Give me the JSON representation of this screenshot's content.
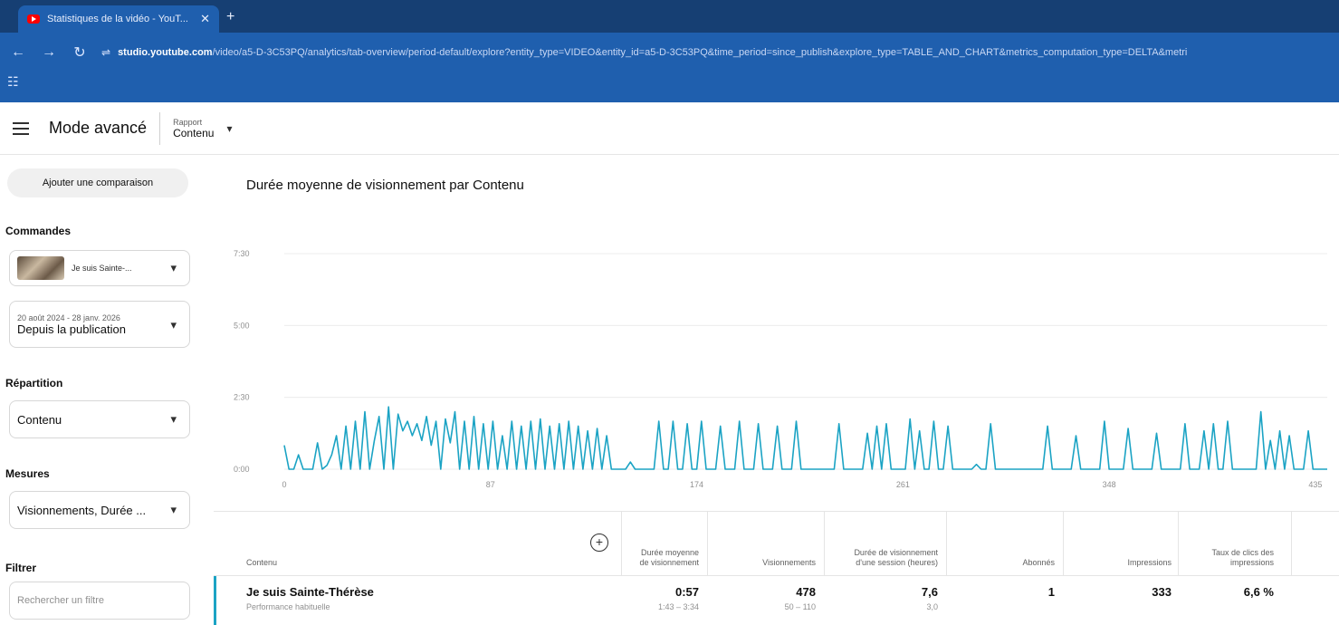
{
  "browser": {
    "tab_title": "Statistiques de la vidéo - YouT...",
    "url_host": "studio.youtube.com",
    "url_path": "/video/a5-D-3C53PQ/analytics/tab-overview/period-default/explore?entity_type=VIDEO&entity_id=a5-D-3C53PQ&time_period=since_publish&explore_type=TABLE_AND_CHART&metrics_computation_type=DELTA&metri",
    "icons": [
      "back-icon",
      "forward-icon",
      "reload-icon",
      "site-info-icon",
      "bookmarks-icon"
    ]
  },
  "header": {
    "title": "Mode avancé",
    "report_label": "Rapport",
    "report_value": "Contenu"
  },
  "sidebar": {
    "compare_button": "Ajouter une comparaison",
    "commandes_title": "Commandes",
    "video_select": "Je suis Sainte-...",
    "date_range": "20 août 2024 - 28 janv. 2026",
    "period": "Depuis la publication",
    "repartition_title": "Répartition",
    "repartition_value": "Contenu",
    "mesures_title": "Mesures",
    "mesures_value": "Visionnements, Durée ...",
    "filtrer_title": "Filtrer",
    "filter_placeholder": "Rechercher un filtre"
  },
  "main": {
    "chart_title": "Durée moyenne de visionnement par Contenu"
  },
  "chart_data": {
    "type": "line",
    "title": "Durée moyenne de visionnement par Contenu",
    "ylim": [
      0,
      450
    ],
    "y_ticks": [
      "0:00",
      "2:30",
      "5:00",
      "7:30"
    ],
    "x_ticks": [
      "0",
      "87",
      "174",
      "261",
      "348",
      "435"
    ],
    "xlim": [
      0,
      440
    ],
    "grid": true,
    "line_color": "#1ba3c4",
    "series": [
      {
        "values": [
          [
            0,
            50
          ],
          [
            2,
            0
          ],
          [
            4,
            0
          ],
          [
            6,
            30
          ],
          [
            8,
            0
          ],
          [
            10,
            0
          ],
          [
            12,
            0
          ],
          [
            14,
            55
          ],
          [
            16,
            0
          ],
          [
            18,
            8
          ],
          [
            20,
            30
          ],
          [
            22,
            70
          ],
          [
            24,
            0
          ],
          [
            26,
            90
          ],
          [
            28,
            0
          ],
          [
            30,
            100
          ],
          [
            32,
            0
          ],
          [
            34,
            120
          ],
          [
            36,
            0
          ],
          [
            38,
            60
          ],
          [
            40,
            110
          ],
          [
            42,
            0
          ],
          [
            44,
            130
          ],
          [
            46,
            0
          ],
          [
            48,
            115
          ],
          [
            50,
            80
          ],
          [
            52,
            100
          ],
          [
            54,
            70
          ],
          [
            56,
            95
          ],
          [
            58,
            60
          ],
          [
            60,
            110
          ],
          [
            62,
            50
          ],
          [
            64,
            100
          ],
          [
            66,
            0
          ],
          [
            68,
            105
          ],
          [
            70,
            55
          ],
          [
            72,
            120
          ],
          [
            74,
            0
          ],
          [
            76,
            100
          ],
          [
            78,
            0
          ],
          [
            80,
            110
          ],
          [
            82,
            0
          ],
          [
            84,
            95
          ],
          [
            86,
            0
          ],
          [
            88,
            100
          ],
          [
            90,
            0
          ],
          [
            92,
            70
          ],
          [
            94,
            0
          ],
          [
            96,
            100
          ],
          [
            98,
            0
          ],
          [
            100,
            90
          ],
          [
            102,
            0
          ],
          [
            104,
            100
          ],
          [
            106,
            0
          ],
          [
            108,
            105
          ],
          [
            110,
            0
          ],
          [
            112,
            90
          ],
          [
            114,
            0
          ],
          [
            116,
            95
          ],
          [
            118,
            0
          ],
          [
            120,
            100
          ],
          [
            122,
            0
          ],
          [
            124,
            90
          ],
          [
            126,
            0
          ],
          [
            128,
            80
          ],
          [
            130,
            0
          ],
          [
            132,
            85
          ],
          [
            134,
            0
          ],
          [
            136,
            70
          ],
          [
            138,
            0
          ],
          [
            140,
            0
          ],
          [
            142,
            0
          ],
          [
            144,
            0
          ],
          [
            146,
            15
          ],
          [
            148,
            0
          ],
          [
            150,
            0
          ],
          [
            152,
            0
          ],
          [
            154,
            0
          ],
          [
            156,
            0
          ],
          [
            158,
            0
          ],
          [
            160,
            0
          ],
          [
            162,
            0
          ],
          [
            164,
            0
          ],
          [
            166,
            0
          ],
          [
            168,
            0
          ],
          [
            170,
            0
          ],
          [
            172,
            0
          ],
          [
            174,
            0
          ],
          [
            176,
            0
          ],
          [
            178,
            0
          ],
          [
            180,
            0
          ],
          [
            182,
            0
          ],
          [
            184,
            0
          ],
          [
            186,
            0
          ],
          [
            188,
            0
          ],
          [
            190,
            0
          ],
          [
            192,
            0
          ],
          [
            194,
            0
          ],
          [
            196,
            0
          ],
          [
            198,
            0
          ],
          [
            200,
            0
          ],
          [
            202,
            0
          ],
          [
            204,
            0
          ],
          [
            206,
            0
          ],
          [
            208,
            0
          ],
          [
            210,
            0
          ],
          [
            212,
            0
          ],
          [
            214,
            0
          ],
          [
            216,
            0
          ],
          [
            218,
            0
          ],
          [
            220,
            0
          ],
          [
            222,
            0
          ],
          [
            224,
            0
          ],
          [
            226,
            0
          ],
          [
            228,
            0
          ],
          [
            230,
            0
          ],
          [
            232,
            0
          ],
          [
            234,
            0
          ],
          [
            236,
            0
          ],
          [
            238,
            0
          ],
          [
            240,
            0
          ],
          [
            242,
            0
          ],
          [
            244,
            0
          ],
          [
            246,
            0
          ],
          [
            248,
            0
          ],
          [
            250,
            0
          ],
          [
            252,
            0
          ],
          [
            254,
            0
          ],
          [
            256,
            0
          ],
          [
            258,
            0
          ],
          [
            260,
            0
          ],
          [
            262,
            0
          ],
          [
            264,
            0
          ],
          [
            266,
            0
          ],
          [
            268,
            0
          ],
          [
            270,
            0
          ],
          [
            272,
            0
          ],
          [
            274,
            0
          ],
          [
            276,
            0
          ],
          [
            278,
            0
          ],
          [
            280,
            0
          ],
          [
            282,
            0
          ],
          [
            284,
            0
          ],
          [
            286,
            0
          ],
          [
            288,
            0
          ],
          [
            290,
            0
          ],
          [
            292,
            0
          ],
          [
            294,
            0
          ],
          [
            296,
            0
          ],
          [
            298,
            0
          ],
          [
            300,
            0
          ],
          [
            302,
            0
          ],
          [
            304,
            0
          ],
          [
            306,
            0
          ],
          [
            308,
            0
          ],
          [
            310,
            0
          ],
          [
            312,
            0
          ],
          [
            314,
            0
          ],
          [
            316,
            0
          ],
          [
            318,
            0
          ],
          [
            320,
            0
          ],
          [
            322,
            0
          ],
          [
            324,
            0
          ],
          [
            326,
            0
          ],
          [
            328,
            0
          ],
          [
            330,
            0
          ],
          [
            332,
            0
          ],
          [
            334,
            0
          ],
          [
            336,
            0
          ],
          [
            338,
            0
          ],
          [
            340,
            0
          ],
          [
            342,
            0
          ],
          [
            344,
            0
          ],
          [
            346,
            0
          ],
          [
            348,
            0
          ],
          [
            350,
            0
          ],
          [
            352,
            0
          ],
          [
            354,
            0
          ],
          [
            356,
            0
          ],
          [
            358,
            0
          ],
          [
            360,
            0
          ],
          [
            362,
            0
          ],
          [
            364,
            0
          ],
          [
            366,
            0
          ],
          [
            368,
            0
          ],
          [
            370,
            0
          ],
          [
            372,
            0
          ],
          [
            374,
            0
          ],
          [
            376,
            0
          ],
          [
            378,
            0
          ],
          [
            380,
            0
          ],
          [
            382,
            0
          ],
          [
            384,
            0
          ],
          [
            386,
            0
          ],
          [
            388,
            0
          ],
          [
            390,
            0
          ],
          [
            392,
            0
          ],
          [
            394,
            0
          ],
          [
            396,
            0
          ],
          [
            398,
            0
          ],
          [
            400,
            0
          ],
          [
            402,
            0
          ],
          [
            404,
            0
          ],
          [
            406,
            0
          ],
          [
            408,
            0
          ],
          [
            410,
            0
          ],
          [
            412,
            0
          ],
          [
            414,
            0
          ],
          [
            416,
            0
          ],
          [
            418,
            0
          ],
          [
            420,
            0
          ],
          [
            422,
            0
          ],
          [
            424,
            0
          ],
          [
            426,
            0
          ],
          [
            428,
            0
          ],
          [
            430,
            0
          ],
          [
            432,
            0
          ],
          [
            434,
            0
          ],
          [
            436,
            0
          ],
          [
            438,
            0
          ],
          [
            440,
            0
          ]
        ]
      }
    ],
    "spikes": [
      [
        158,
        100
      ],
      [
        164,
        100
      ],
      [
        170,
        95
      ],
      [
        176,
        100
      ],
      [
        184,
        90
      ],
      [
        192,
        100
      ],
      [
        200,
        95
      ],
      [
        208,
        90
      ],
      [
        216,
        100
      ],
      [
        234,
        95
      ],
      [
        246,
        75
      ],
      [
        250,
        90
      ],
      [
        254,
        95
      ],
      [
        264,
        105
      ],
      [
        268,
        80
      ],
      [
        274,
        100
      ],
      [
        280,
        90
      ],
      [
        292,
        10
      ],
      [
        298,
        95
      ],
      [
        322,
        90
      ],
      [
        334,
        70
      ],
      [
        346,
        100
      ],
      [
        356,
        85
      ],
      [
        368,
        75
      ],
      [
        380,
        95
      ],
      [
        388,
        80
      ],
      [
        392,
        95
      ],
      [
        398,
        100
      ],
      [
        412,
        120
      ],
      [
        416,
        60
      ],
      [
        420,
        80
      ],
      [
        424,
        70
      ],
      [
        432,
        80
      ]
    ]
  },
  "table": {
    "headers": [
      "Contenu",
      "Durée moyenne de visionnement",
      "Visionnements",
      "Durée de visionnement d'une session (heures)",
      "Abonnés",
      "Impressions",
      "Taux de clics des impressions"
    ],
    "row": {
      "title": "Je suis Sainte-Thérèse",
      "subtitle": "Performance habituelle",
      "cells": [
        {
          "value": "0:57",
          "range": "1:43 – 3:34"
        },
        {
          "value": "478",
          "range": "50 – 110"
        },
        {
          "value": "7,6",
          "range": "3,0"
        },
        {
          "value": "1",
          "range": ""
        },
        {
          "value": "333",
          "range": ""
        },
        {
          "value": "6,6 %",
          "range": ""
        }
      ]
    }
  }
}
